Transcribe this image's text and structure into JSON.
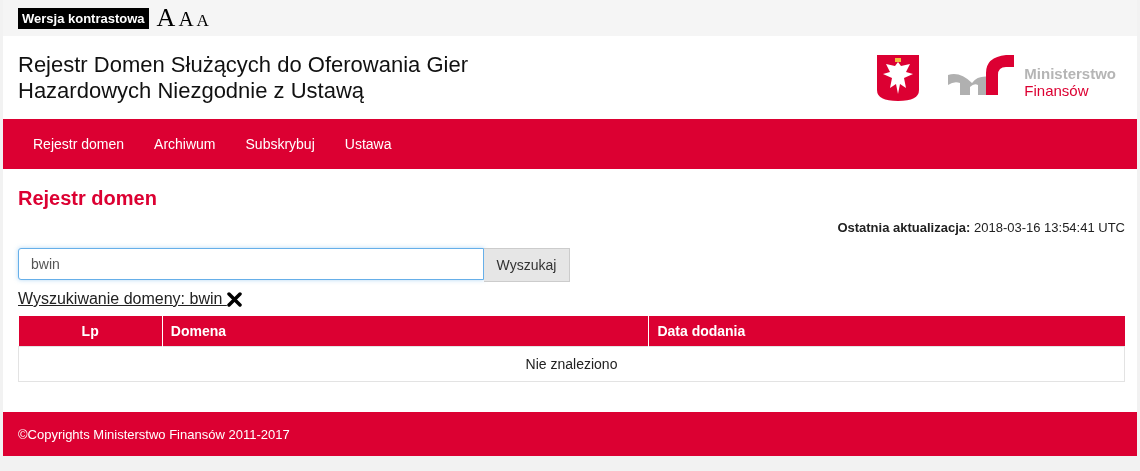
{
  "top_bar": {
    "contrast_button": "Wersja kontrastowa",
    "font_sizes": [
      "A",
      "A",
      "A"
    ]
  },
  "header": {
    "title_lines": [
      "Rejestr Domen Służących do Oferowania Gier",
      "Hazardowych Niezgodnie z Ustawą"
    ],
    "logo_text": [
      "Ministerstwo",
      "Finansów"
    ]
  },
  "nav": {
    "items": [
      "Rejestr domen",
      "Archiwum",
      "Subskrybuj",
      "Ustawa"
    ]
  },
  "page_title": "Rejestr domen",
  "last_update": "**Ostatnia aktualizacja:** 2018-03-16 13:54:41 UTC",
  "search": {
    "value": "bwin",
    "button": "Wyszukaj"
  },
  "search_filter": "Wyszukiwanie domeny: bwin ",
  "table": {
    "columns": [
      "Lp",
      "Domena",
      "Data dodania"
    ],
    "empty_message": "Nie znaleziono"
  },
  "footer": "©Copyrights Ministerstwo Finansów 2011-2017"
}
